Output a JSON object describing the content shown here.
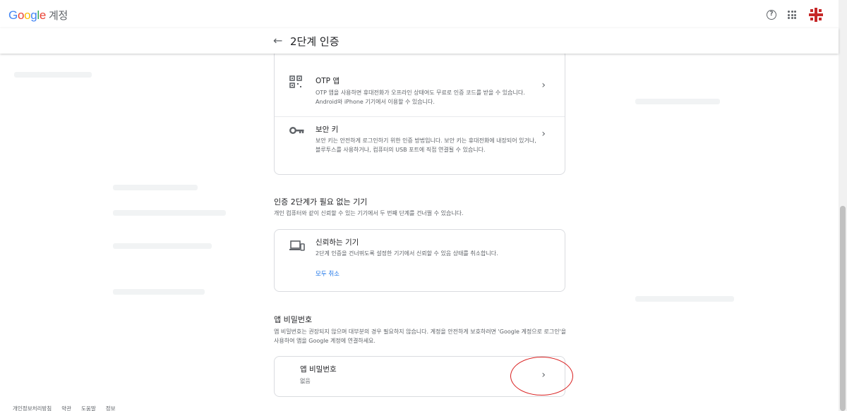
{
  "app": {
    "logo_text": "Google",
    "account_label": "계정"
  },
  "header": {
    "back_icon": "arrow-back-icon",
    "title": "2단계 인증"
  },
  "methods": [
    {
      "title": "OTP 앱",
      "description": "OTP 앱을 사용하면 휴대전화가 오프라인 상태여도 무료로 인증 코드를 받을 수 있습니다. Android와 iPhone 기기에서 이용할 수 있습니다.",
      "icon": "qr-code-icon"
    },
    {
      "title": "보안 키",
      "description": "보안 키는 안전하게 로그인하기 위한 인증 방법입니다. 보안 키는 휴대전화에 내장되어 있거나, 블루투스를 사용하거나, 컴퓨터의 USB 포트에 직접 연결될 수 있습니다.",
      "icon": "key-icon"
    }
  ],
  "trusted_section": {
    "title": "인증 2단계가 필요 없는 기기",
    "description": "개인 컴퓨터와 같이 신뢰할 수 있는 기기에서 두 번째 단계를 건너뛸 수 있습니다.",
    "card_title": "신뢰하는 기기",
    "card_desc": "2단계 인증을 건너뛰도록 설정한 기기에서 신뢰할 수 있음 상태를 취소합니다.",
    "revoke_link": "모두 취소",
    "icon": "devices-icon"
  },
  "app_password_section": {
    "title": "앱 비밀번호",
    "description": "앱 비밀번호는 권장되지 않으며 대부분의 경우 필요하지 않습니다. 계정을 안전하게 보호하려면 'Google 계정으로 로그인'을 사용하여 앱을 Google 계정에 연결하세요.",
    "card_title": "앱 비밀번호",
    "card_value": "없음"
  },
  "footer": {
    "links": [
      "개인정보처리방침",
      "약관",
      "도움말",
      "정보"
    ]
  },
  "colors": {
    "link": "#1a73e8",
    "annotation": "#d92020",
    "text": "#202124",
    "secondary": "#5f6368"
  }
}
